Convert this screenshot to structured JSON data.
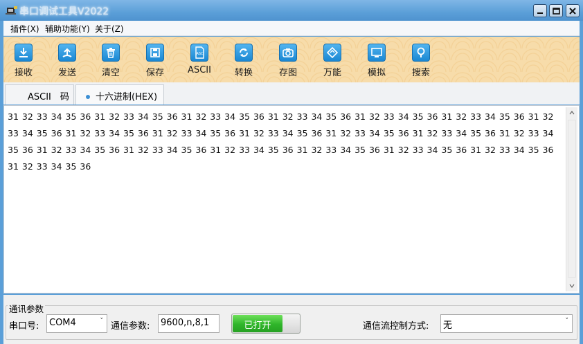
{
  "window": {
    "title": "串口调试工具V2022"
  },
  "menu": [
    {
      "label": "插件(X)"
    },
    {
      "label": "辅助功能(Y)"
    },
    {
      "label": "关于(Z)"
    }
  ],
  "toolbar": [
    {
      "label": "接收",
      "icon": "download-icon"
    },
    {
      "label": "发送",
      "icon": "upload-icon"
    },
    {
      "label": "清空",
      "icon": "trash-icon"
    },
    {
      "label": "保存",
      "icon": "save-icon"
    },
    {
      "label": "ASCII",
      "icon": "ascii-file-icon"
    },
    {
      "label": "转换",
      "icon": "convert-icon"
    },
    {
      "label": "存图",
      "icon": "camera-icon"
    },
    {
      "label": "万能",
      "icon": "universal-icon"
    },
    {
      "label": "模拟",
      "icon": "monitor-icon"
    },
    {
      "label": "搜索",
      "icon": "search-icon"
    }
  ],
  "tabs": [
    {
      "label": "ASCII　码"
    },
    {
      "label": "十六进制(HEX)",
      "active": true
    }
  ],
  "content": {
    "hex_text": "31 32 33 34 35 36 31 32 33 34 35 36 31 32 33 34 35 36 31 32 33 34 35 36 31 32 33 34 35 36 31 32 33 34 35 36 31 32 33 34 35 36 31 32 33 34 35 36 31 32 33 34 35 36 31 32 33 34 35 36 31 32 33 34 35 36 31 32 33 34 35 36 31 32 33 34 35 36 31 32 33 34 35 36 31 32 33 34 35 36 31 32 33 34 35 36 31 32 33 34 35 36 31 32 33 34 35 36 31 32 33 34 35 36 31 32 33 34 35 36"
  },
  "comm": {
    "group_title": "通讯参数",
    "port_label": "串口号:",
    "port_value": "COM4",
    "params_label": "通信参数:",
    "params_value": "9600,n,8,1",
    "toggle_label": "已打开",
    "flow_label": "通信流控制方式:",
    "flow_value": "无"
  },
  "colors": {
    "titlebar": "#5b9fd8",
    "toolbar_bg": "#f7dcaa",
    "icon_blue": "#1a87d3",
    "toggle_green": "#2fb52a"
  }
}
